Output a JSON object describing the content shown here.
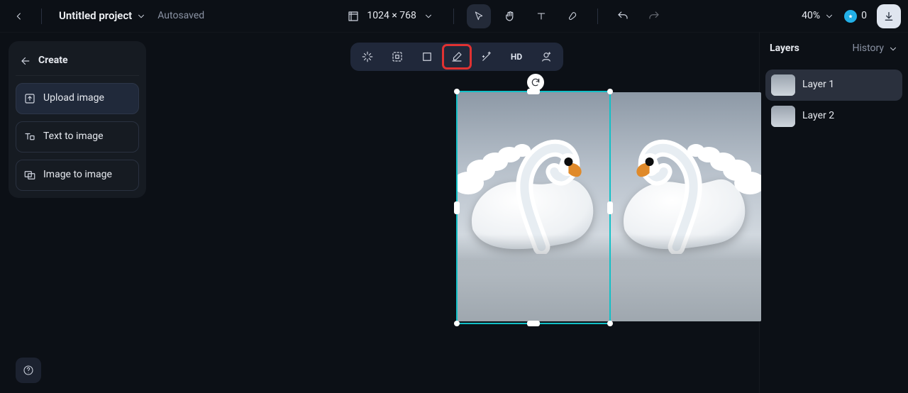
{
  "header": {
    "project_title": "Untitled project",
    "save_status": "Autosaved",
    "dimensions_label": "1024 × 768",
    "zoom_label": "40%",
    "credits": "0"
  },
  "left_panel": {
    "create_label": "Create",
    "actions": {
      "upload": "Upload image",
      "text_to_image": "Text to image",
      "image_to_image": "Image to image"
    }
  },
  "toolbar": {
    "items": {
      "hd_label": "HD"
    }
  },
  "right_panel": {
    "layers_title": "Layers",
    "history_label": "History",
    "layers": [
      {
        "name": "Layer 1",
        "selected": true
      },
      {
        "name": "Layer 2",
        "selected": false
      }
    ]
  }
}
